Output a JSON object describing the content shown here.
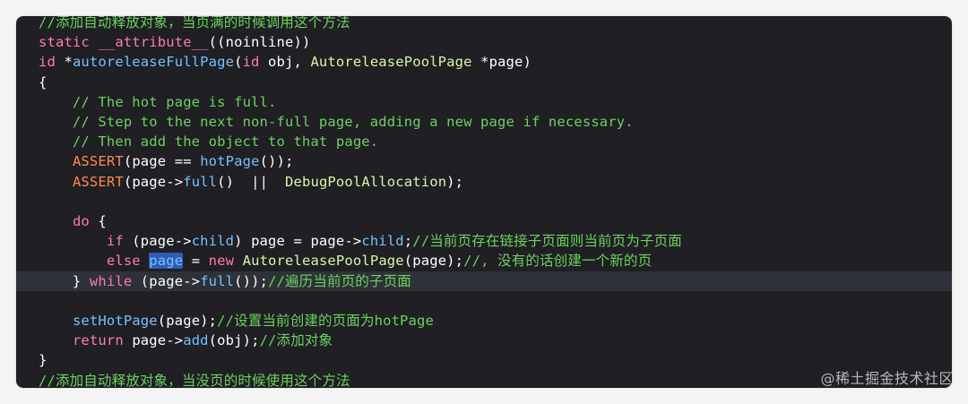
{
  "editor": {
    "lines": [
      {
        "segments": [
          {
            "t": "//添加自动释放对象，当页满的时候调用这个方法",
            "c": "cm"
          }
        ]
      },
      {
        "segments": [
          {
            "t": "static ",
            "c": "kw"
          },
          {
            "t": "__attribute__",
            "c": "kw"
          },
          {
            "t": "((noinline))",
            "c": "pl"
          }
        ]
      },
      {
        "segments": [
          {
            "t": "id",
            "c": "kw"
          },
          {
            "t": " *",
            "c": "pl"
          },
          {
            "t": "autoreleaseFullPage",
            "c": "fn"
          },
          {
            "t": "(",
            "c": "pl"
          },
          {
            "t": "id",
            "c": "kw"
          },
          {
            "t": " obj, ",
            "c": "pl"
          },
          {
            "t": "AutoreleasePoolPage",
            "c": "ty"
          },
          {
            "t": " *page)",
            "c": "pl"
          }
        ]
      },
      {
        "segments": [
          {
            "t": "{",
            "c": "pl"
          }
        ]
      },
      {
        "segments": [
          {
            "t": "    // The hot page is full.",
            "c": "cm"
          }
        ]
      },
      {
        "segments": [
          {
            "t": "    // Step to the next non-full page, adding a new page if necessary.",
            "c": "cm"
          }
        ]
      },
      {
        "segments": [
          {
            "t": "    // Then add the object to that page.",
            "c": "cm"
          }
        ]
      },
      {
        "segments": [
          {
            "t": "    ",
            "c": "pl"
          },
          {
            "t": "ASSERT",
            "c": "mc"
          },
          {
            "t": "(page == ",
            "c": "pl"
          },
          {
            "t": "hotPage",
            "c": "fn"
          },
          {
            "t": "());",
            "c": "pl"
          }
        ]
      },
      {
        "segments": [
          {
            "t": "    ",
            "c": "pl"
          },
          {
            "t": "ASSERT",
            "c": "mc"
          },
          {
            "t": "(page->",
            "c": "pl"
          },
          {
            "t": "full",
            "c": "fn"
          },
          {
            "t": "()  ||  ",
            "c": "pl"
          },
          {
            "t": "DebugPoolAllocation",
            "c": "ty"
          },
          {
            "t": ");",
            "c": "pl"
          }
        ]
      },
      {
        "segments": [
          {
            "t": "",
            "c": "pl"
          }
        ]
      },
      {
        "segments": [
          {
            "t": "    ",
            "c": "pl"
          },
          {
            "t": "do",
            "c": "kw"
          },
          {
            "t": " {",
            "c": "pl"
          }
        ]
      },
      {
        "segments": [
          {
            "t": "        ",
            "c": "pl"
          },
          {
            "t": "if",
            "c": "kw"
          },
          {
            "t": " (page->",
            "c": "pl"
          },
          {
            "t": "child",
            "c": "fn"
          },
          {
            "t": ") page = page->",
            "c": "pl"
          },
          {
            "t": "child",
            "c": "fn"
          },
          {
            "t": ";",
            "c": "pl"
          },
          {
            "t": "//当前页存在链接子页面则当前页为子页面",
            "c": "cm"
          }
        ]
      },
      {
        "segments": [
          {
            "t": "        ",
            "c": "pl"
          },
          {
            "t": "else",
            "c": "kw"
          },
          {
            "t": " ",
            "c": "pl"
          },
          {
            "t": "page",
            "c": "fn",
            "sel": true
          },
          {
            "t": " = ",
            "c": "pl"
          },
          {
            "t": "new",
            "c": "kw"
          },
          {
            "t": " ",
            "c": "pl"
          },
          {
            "t": "AutoreleasePoolPage",
            "c": "ty"
          },
          {
            "t": "(page);",
            "c": "pl"
          },
          {
            "t": "//, 没有的话创建一个新的页",
            "c": "cm"
          }
        ]
      },
      {
        "active": true,
        "segments": [
          {
            "t": "    } ",
            "c": "pl"
          },
          {
            "t": "while",
            "c": "kw"
          },
          {
            "t": " (page->",
            "c": "pl"
          },
          {
            "t": "full",
            "c": "fn"
          },
          {
            "t": "());",
            "c": "pl"
          },
          {
            "t": "//遍历当前页的子页面",
            "c": "cm"
          }
        ]
      },
      {
        "segments": [
          {
            "t": "",
            "c": "pl"
          }
        ]
      },
      {
        "segments": [
          {
            "t": "    ",
            "c": "pl"
          },
          {
            "t": "setHotPage",
            "c": "fn"
          },
          {
            "t": "(page);",
            "c": "pl"
          },
          {
            "t": "//设置当前创建的页面为hotPage",
            "c": "cm"
          }
        ]
      },
      {
        "segments": [
          {
            "t": "    ",
            "c": "pl"
          },
          {
            "t": "return",
            "c": "kw"
          },
          {
            "t": " page->",
            "c": "pl"
          },
          {
            "t": "add",
            "c": "fn"
          },
          {
            "t": "(obj);",
            "c": "pl"
          },
          {
            "t": "//添加对象",
            "c": "cm"
          }
        ]
      },
      {
        "segments": [
          {
            "t": "}",
            "c": "pl"
          }
        ]
      },
      {
        "segments": [
          {
            "t": "//添加自动释放对象，当没页的时候使用这个方法",
            "c": "cm"
          }
        ]
      }
    ]
  },
  "watermark": "@稀土掘金技术社区",
  "colors": {
    "background": "#1f1f24",
    "keyword": "#ff7ab2",
    "comment": "#6bd25d",
    "function": "#72c2ff",
    "type": "#d8f6a6",
    "macro": "#ff8a4d",
    "selection": "#2f5cb8",
    "active_line": "#2f3138"
  }
}
